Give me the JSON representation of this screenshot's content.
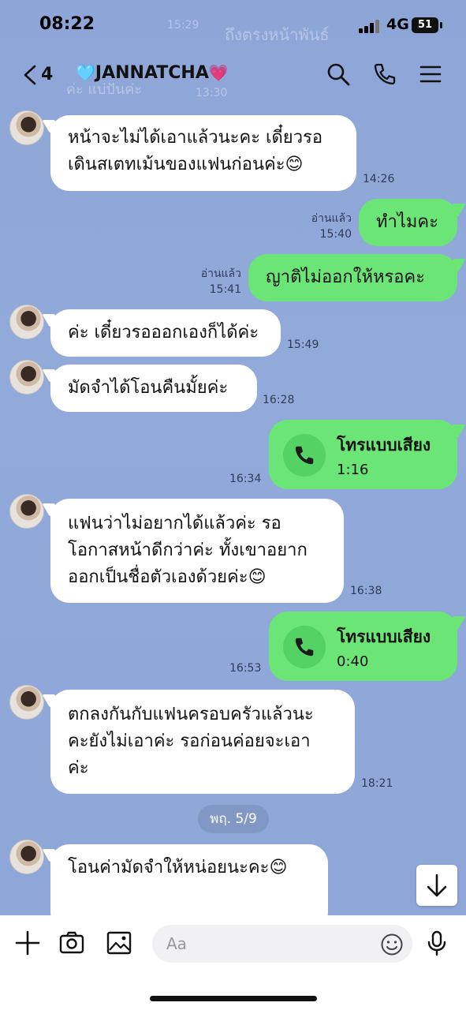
{
  "status_bar": {
    "time": "08:22",
    "network": "4G",
    "battery": "51"
  },
  "header": {
    "back_count": "4",
    "title": "JANNATCHA",
    "heart_left": "🩵",
    "heart_right": "💗"
  },
  "backdrop": {
    "top_text": "ถึงตรงหน้าพันธ์",
    "faded_line1": "ค่ะ แบ่ปันค่ะ",
    "faded_time1": "15:29",
    "faded_time2": "13:30"
  },
  "messages": [
    {
      "side": "in",
      "text": "หน้าจะไม่ได้เอาแล้วนะคะ เดี๋ยวรอ\nเดินสเตทเม้นของแฟนก่อนค่ะ😊",
      "time": "14:26"
    },
    {
      "side": "out",
      "read": "อ่านแล้ว",
      "text": "ทำไมคะ",
      "time": "15:40"
    },
    {
      "side": "out",
      "read": "อ่านแล้ว",
      "text": "ญาติไม่ออกให้หรอคะ",
      "time": "15:41"
    },
    {
      "side": "in",
      "text": "ค่ะ เดี๋ยวรอออกเองก็ได้ค่ะ",
      "time": "15:49"
    },
    {
      "side": "in",
      "text": "มัดจำได้โอนคืนมั้ยค่ะ",
      "time": "16:28"
    },
    {
      "side": "out",
      "type": "call",
      "text": "โทรแบบเสียง",
      "duration": "1:16",
      "time": "16:34"
    },
    {
      "side": "in",
      "text": "แฟนว่าไม่อยากได้แล้วค่ะ รอ\nโอกาสหน้าดีกว่าค่ะ ทั้งเขาอยาก\nออกเป็นชื่อตัวเองด้วยค่ะ😊",
      "time": "16:38"
    },
    {
      "side": "out",
      "type": "call",
      "text": "โทรแบบเสียง",
      "duration": "0:40",
      "time": "16:53"
    },
    {
      "side": "in",
      "text": "ตกลงกันกับแฟนครอบครัวแล้วนะ\nคะยังไม่เอาค่ะ รอก่อนค่อยจะเอา\nค่ะ",
      "time": "18:21"
    },
    {
      "side": "in",
      "text": "โอนค่ามัดจำให้หน่อยนะคะ😊",
      "time": ""
    }
  ],
  "date_separator": "พฤ. 5/9",
  "input": {
    "placeholder": "Aa"
  },
  "icons": {
    "back": "chevron-left-icon",
    "search": "search-icon",
    "call": "phone-icon",
    "menu": "menu-icon",
    "plus": "plus-icon",
    "camera": "camera-icon",
    "image": "image-icon",
    "emoji": "emoji-icon",
    "mic": "mic-icon",
    "scroll": "arrow-down-icon"
  },
  "colors": {
    "background": "#8FA7D8",
    "outgoing": "#6BE576",
    "incoming": "#FFFFFF"
  }
}
